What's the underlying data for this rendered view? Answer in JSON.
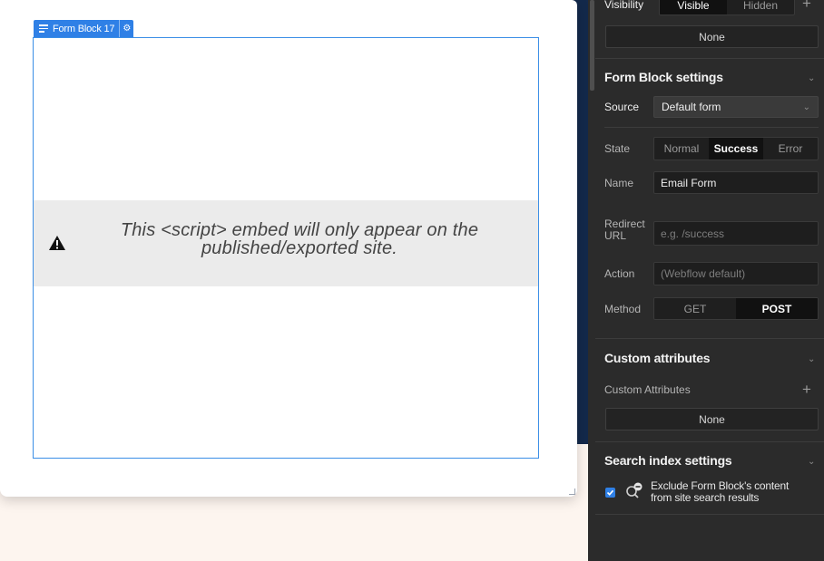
{
  "canvas": {
    "form_block_tag": "Form Block 17",
    "embed_line1": "This <script> embed will only appear on the",
    "embed_line2": "published/exported site."
  },
  "panel": {
    "visibility": {
      "label": "Visibility",
      "options": [
        "Visible",
        "Hidden"
      ],
      "selected": "Visible",
      "add": "+",
      "none": "None"
    },
    "form_block_settings": {
      "title": "Form Block settings",
      "source_label": "Source",
      "source_value": "Default form",
      "state_label": "State",
      "state_options": [
        "Normal",
        "Success",
        "Error"
      ],
      "state_selected": "Success",
      "name_label": "Name",
      "name_value": "Email Form",
      "redirect_label_1": "Redirect",
      "redirect_label_2": "URL",
      "redirect_placeholder": "e.g. /success",
      "action_label": "Action",
      "action_placeholder": "(Webflow default)",
      "method_label": "Method",
      "method_options": [
        "GET",
        "POST"
      ],
      "method_selected": "POST"
    },
    "custom_attributes": {
      "title": "Custom attributes",
      "label": "Custom Attributes",
      "add": "+",
      "none": "None"
    },
    "search_index": {
      "title": "Search index settings",
      "exclude_line1": "Exclude Form Block's content",
      "exclude_line2": "from site search results",
      "checked": true
    }
  }
}
